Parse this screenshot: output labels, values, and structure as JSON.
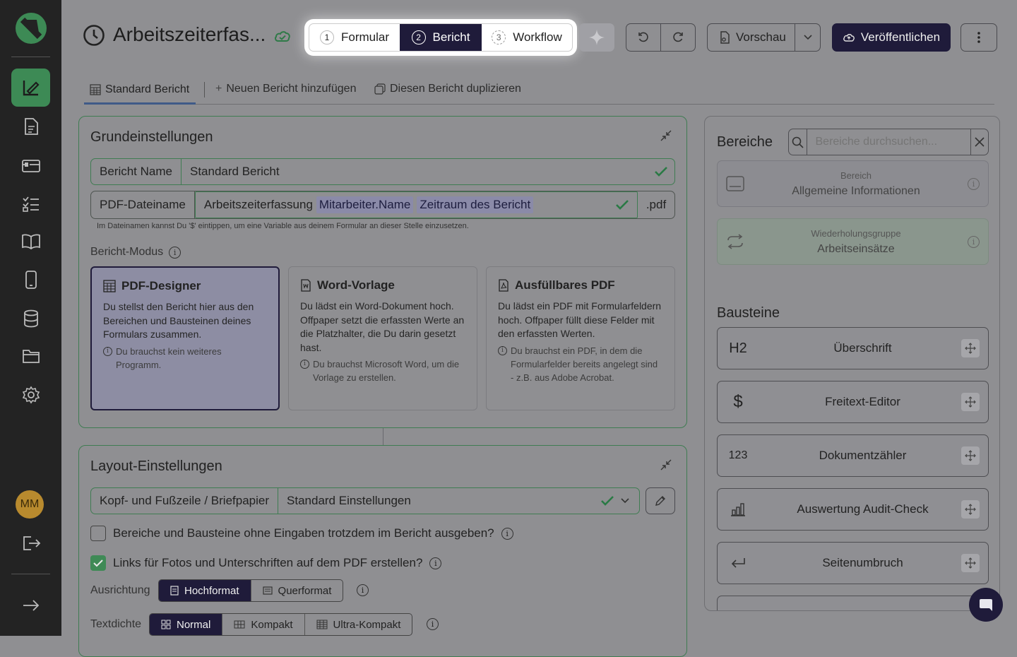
{
  "header": {
    "title": "Arbeitszeiterfas...",
    "steps": [
      {
        "num": "1",
        "label": "Formular"
      },
      {
        "num": "2",
        "label": "Bericht"
      },
      {
        "num": "3",
        "label": "Workflow"
      }
    ],
    "preview_label": "Vorschau",
    "publish_label": "Veröffentlichen"
  },
  "tabs": {
    "standard": "Standard Bericht",
    "add": "Neuen Bericht hinzufügen",
    "duplicate": "Diesen Bericht duplizieren"
  },
  "basic": {
    "title": "Grundeinstellungen",
    "report_name_label": "Bericht Name",
    "report_name_value": "Standard Bericht",
    "pdf_label": "PDF-Dateiname",
    "pdf_value": "Arbeitszeiterfassung",
    "pdf_vars": [
      "Mitarbeiter.Name",
      "Zeitraum des Bericht"
    ],
    "pdf_ext": ".pdf",
    "hint": "Im Dateinamen kannst Du '$' eintippen, um eine Variable aus deinem Formular an dieser Stelle einzusetzen.",
    "mode_label": "Bericht-Modus",
    "modes": [
      {
        "title": "PDF-Designer",
        "desc": "Du stellst den Bericht hier aus den Bereichen und Bausteinen deines Formulars zusammen.",
        "note": "Du brauchst kein weiteres Programm."
      },
      {
        "title": "Word-Vorlage",
        "desc": "Du lädst ein Word-Dokument hoch. Offpaper setzt die erfassten Werte an die Platzhalter, die Du darin gesetzt hast.",
        "note": "Du brauchst Microsoft Word, um die Vorlage zu erstellen."
      },
      {
        "title": "Ausfüllbares PDF",
        "desc": "Du lädst ein PDF mit Formularfeldern hoch. Offpaper füllt diese Felder mit den erfassten Werten.",
        "note": "Du brauchst ein PDF, in dem die Formularfelder bereits angelegt sind - z.B. aus Adobe Acrobat."
      }
    ]
  },
  "layout": {
    "title": "Layout-Einstellungen",
    "header_label": "Kopf- und Fußzeile / Briefpapier",
    "header_value": "Standard Einstellungen",
    "cb1": "Bereiche und Bausteine ohne Eingaben trotzdem im Bericht ausgeben?",
    "cb2": "Links für Fotos und Unterschriften auf dem PDF erstellen?",
    "orientation_label": "Ausrichtung",
    "orientation": [
      "Hochformat",
      "Querformat"
    ],
    "density_label": "Textdichte",
    "density": [
      "Normal",
      "Kompakt",
      "Ultra-Kompakt"
    ]
  },
  "right": {
    "areas_title": "Bereiche",
    "search_placeholder": "Bereiche durchsuchen...",
    "areas": [
      {
        "type": "Bereich",
        "name": "Allgemeine Informationen"
      },
      {
        "type": "Wiederholungsgruppe",
        "name": "Arbeitseinsätze"
      }
    ],
    "blocks_title": "Bausteine",
    "blocks": [
      {
        "icon": "H2",
        "label": "Überschrift"
      },
      {
        "icon": "$",
        "label": "Freitext-Editor"
      },
      {
        "icon": "123",
        "label": "Dokumentzähler"
      },
      {
        "icon": "chart",
        "label": "Auswertung Audit-Check"
      },
      {
        "icon": "return",
        "label": "Seitenumbruch"
      }
    ]
  },
  "user": {
    "initials": "MM"
  }
}
